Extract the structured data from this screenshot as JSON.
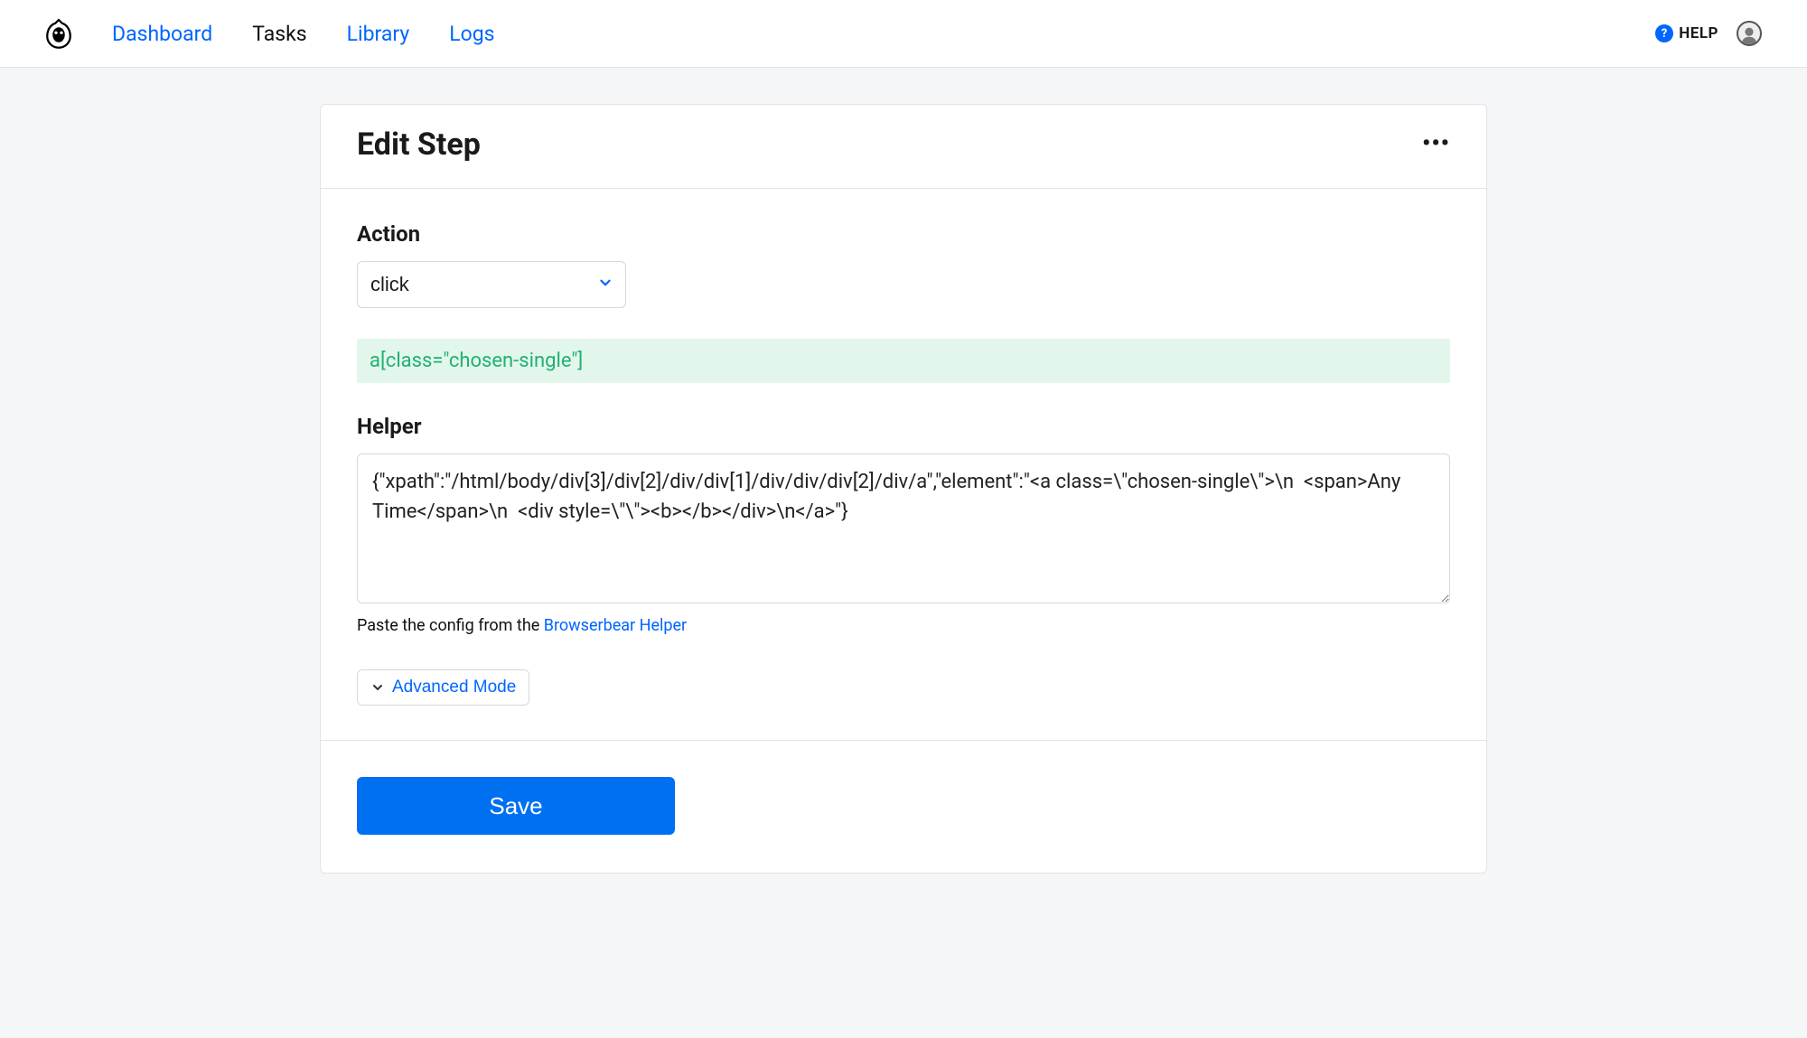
{
  "nav": {
    "items": [
      {
        "label": "Dashboard",
        "active": false
      },
      {
        "label": "Tasks",
        "active": true
      },
      {
        "label": "Library",
        "active": false
      },
      {
        "label": "Logs",
        "active": false
      }
    ]
  },
  "header": {
    "help_label": "HELP"
  },
  "page": {
    "title": "Edit Step",
    "action_label": "Action",
    "action_value": "click",
    "selector_preview": "a[class=\"chosen-single\"]",
    "helper_label": "Helper",
    "helper_value": "{\"xpath\":\"/html/body/div[3]/div[2]/div/div[1]/div/div/div[2]/div/a\",\"element\":\"<a class=\\\"chosen-single\\\">\\n  <span>Any Time</span>\\n  <div style=\\\"\\\"><b></b></div>\\n</a>\"}",
    "hint_prefix": "Paste the config from the ",
    "hint_link": "Browserbear Helper",
    "advanced_label": "Advanced Mode",
    "save_label": "Save"
  }
}
